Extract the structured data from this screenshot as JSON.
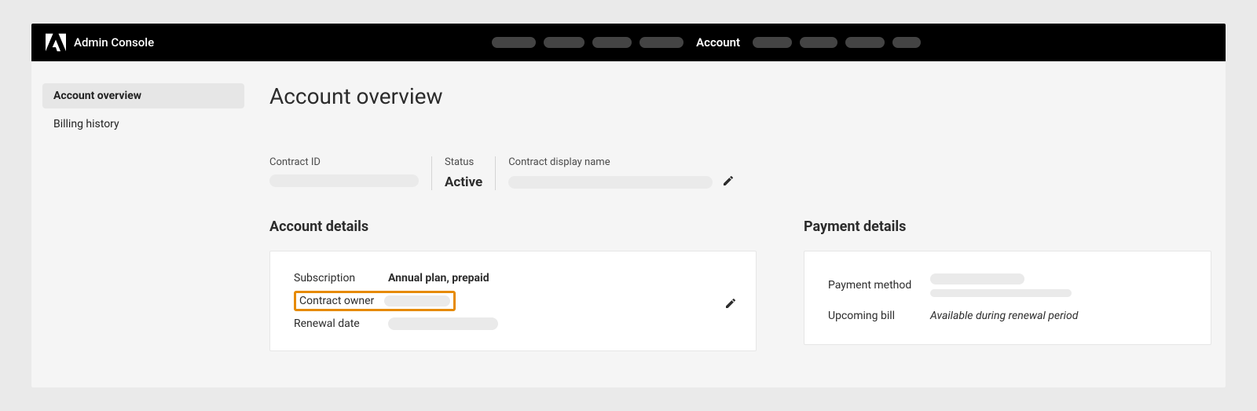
{
  "header": {
    "app_title": "Admin Console",
    "active_tab": "Account"
  },
  "sidebar": {
    "items": [
      {
        "label": "Account overview",
        "active": true
      },
      {
        "label": "Billing history",
        "active": false
      }
    ]
  },
  "page": {
    "title": "Account overview",
    "meta": {
      "contract_id_label": "Contract ID",
      "status_label": "Status",
      "status_value": "Active",
      "display_name_label": "Contract display name"
    },
    "account_details": {
      "section_title": "Account details",
      "subscription_label": "Subscription",
      "subscription_value": "Annual plan, prepaid",
      "contract_owner_label": "Contract owner",
      "renewal_date_label": "Renewal date"
    },
    "payment_details": {
      "section_title": "Payment details",
      "payment_method_label": "Payment method",
      "upcoming_bill_label": "Upcoming bill",
      "upcoming_bill_value": "Available during renewal period"
    }
  }
}
